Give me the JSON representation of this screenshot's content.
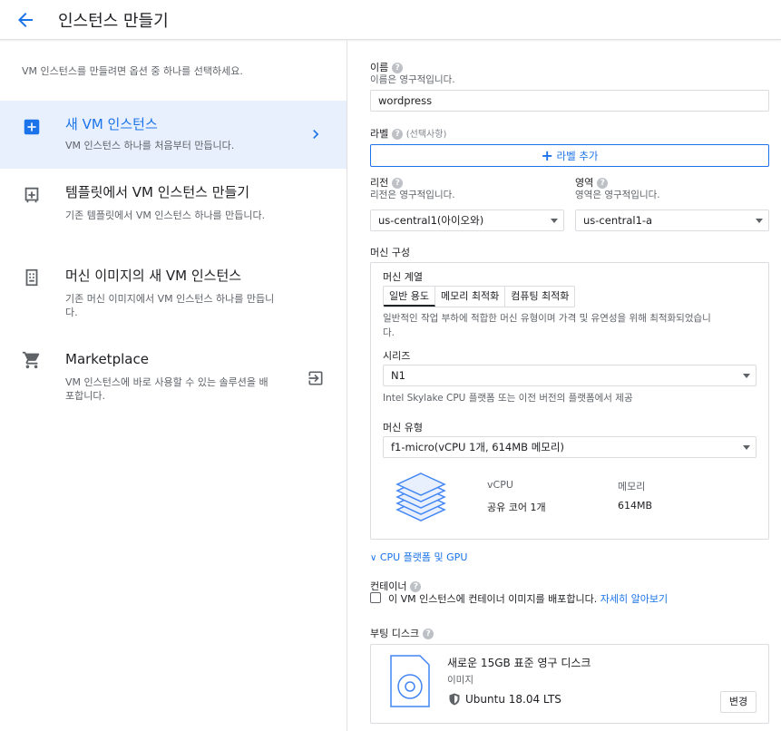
{
  "header": {
    "title": "인스턴스 만들기"
  },
  "left": {
    "intro": "VM 인스턴스를 만들려면 옵션 중 하나를 선택하세요.",
    "options": [
      {
        "title": "새 VM 인스턴스",
        "desc": "VM 인스턴스 하나를 처음부터 만듭니다."
      },
      {
        "title": "템플릿에서 VM 인스턴스 만들기",
        "desc": "기존 템플릿에서 VM 인스턴스 하나를 만듭니다."
      },
      {
        "title": "머신 이미지의 새 VM 인스턴스",
        "desc": "기존 머신 이미지에서 VM 인스턴스 하나를 만듭니다."
      },
      {
        "title": "Marketplace",
        "desc": "VM 인스턴스에 바로 사용할 수 있는 솔루션을 배포합니다."
      }
    ]
  },
  "form": {
    "name": {
      "label": "이름",
      "help": "?",
      "sub": "이름은 영구적입니다.",
      "value": "wordpress"
    },
    "labels": {
      "label": "라벨",
      "optional": "(선택사항)",
      "add_button": "라벨 추가"
    },
    "region": {
      "label": "리전",
      "sub": "리전은 영구적입니다.",
      "value": "us-central1(아이오와)"
    },
    "zone": {
      "label": "영역",
      "sub": "영역은 영구적입니다.",
      "value": "us-central1-a"
    },
    "machine_config": {
      "label": "머신 구성",
      "family_label": "머신 계열",
      "tabs": [
        "일반 용도",
        "메모리 최적화",
        "컴퓨팅 최적화"
      ],
      "family_desc_1": "일반적인 작업 부하에 적합한 머신 유형이며 가격 및 유연성을 위해 최적화되었습니",
      "family_desc_2": "다.",
      "series_label": "시리즈",
      "series_value": "N1",
      "series_desc": "Intel Skylake CPU 플랫폼 또는 이전 버전의 플랫폼에서 제공",
      "type_label": "머신 유형",
      "type_value": "f1-micro(vCPU 1개, 614MB 메모리)",
      "vcpu_header": "vCPU",
      "memory_header": "메모리",
      "vcpu_value": "공유 코어 1개",
      "memory_value": "614MB"
    },
    "cpu_platform_link": "CPU 플랫폼 및 GPU",
    "container": {
      "label": "컨테이너",
      "checkbox_text": "이 VM 인스턴스에 컨테이너 이미지를 배포합니다.",
      "learn_more": "자세히 알아보기"
    },
    "boot_disk": {
      "label": "부팅 디스크",
      "title": "새로운 15GB 표준 영구 디스크",
      "image_label": "이미지",
      "image_value": "Ubuntu 18.04 LTS",
      "change_button": "변경"
    }
  },
  "colors": {
    "accent": "#1a73e8",
    "selected_bg": "#e8f0fe",
    "icon_gray": "#5f6368"
  }
}
